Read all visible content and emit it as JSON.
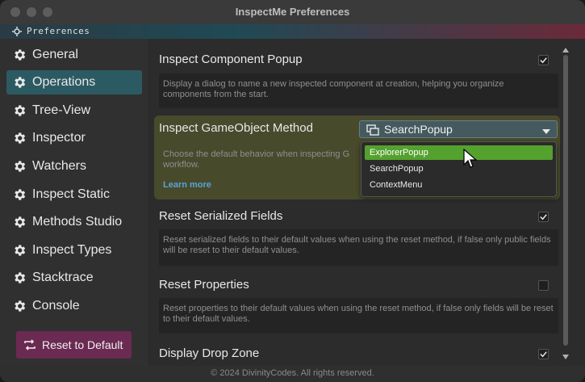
{
  "window": {
    "title": "InspectMe Preferences"
  },
  "header": {
    "label": "Preferences"
  },
  "sidebar": {
    "items": [
      {
        "label": "General"
      },
      {
        "label": "Operations"
      },
      {
        "label": "Tree-View"
      },
      {
        "label": "Inspector"
      },
      {
        "label": "Watchers"
      },
      {
        "label": "Inspect Static"
      },
      {
        "label": "Methods Studio"
      },
      {
        "label": "Inspect Types"
      },
      {
        "label": "Stacktrace"
      },
      {
        "label": "Console"
      }
    ],
    "active": "Operations",
    "reset_label": "Reset to Default"
  },
  "settings": {
    "component_popup": {
      "title": "Inspect Component Popup",
      "desc": "Display a dialog to name a new inspected component at creation, helping you organize components from the start.",
      "checked": true
    },
    "gameobject_method": {
      "title": "Inspect GameObject Method",
      "desc": "Choose the default behavior when inspecting G",
      "desc2": "workflow.",
      "learn_more": "Learn more",
      "selected": "SearchPopup",
      "options": [
        "ExplorerPopup",
        "SearchPopup",
        "ContextMenu"
      ],
      "highlighted_option": "ExplorerPopup"
    },
    "reset_serialized": {
      "title": "Reset Serialized Fields",
      "desc": "Reset serialized fields to their default values when using the reset method, if false only public fields will be reset to their default values.",
      "checked": true
    },
    "reset_properties": {
      "title": "Reset Properties",
      "desc": "Reset properties to their default values when using the reset method, if false only fields will be reset to their default values.",
      "checked": false
    },
    "drop_zone": {
      "title": "Display Drop Zone",
      "checked": true
    }
  },
  "footer": {
    "copyright": "© 2024 DivinityCodes. All rights reserved."
  },
  "colors": {
    "accent_active": "#2c5a63",
    "reset_button": "#6b2a52",
    "popup_selected": "#54a12e",
    "link": "#5aa3d9",
    "highlight": "#484a2c"
  }
}
